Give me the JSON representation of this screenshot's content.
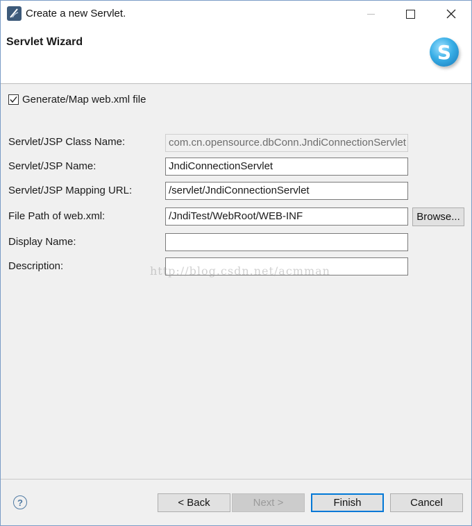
{
  "window": {
    "title": "Create a new Servlet.",
    "min_icon": "minimize-icon",
    "max_icon": "maximize-icon",
    "close_glyph": "✕"
  },
  "header": {
    "wizard_title": "Servlet Wizard",
    "logo_letter": "S"
  },
  "form": {
    "generate_checkbox": {
      "label": "Generate/Map web.xml file",
      "checked": true
    },
    "class_name": {
      "label": "Servlet/JSP Class Name:",
      "value": "com.cn.opensource.dbConn.JndiConnectionServlet"
    },
    "servlet_name": {
      "label": "Servlet/JSP Name:",
      "value": "JndiConnectionServlet"
    },
    "mapping_url": {
      "label": "Servlet/JSP Mapping URL:",
      "value": "/servlet/JndiConnectionServlet"
    },
    "file_path": {
      "label": "File Path of web.xml:",
      "value": "/JndiTest/WebRoot/WEB-INF"
    },
    "display_name": {
      "label": "Display Name:",
      "value": ""
    },
    "description": {
      "label": "Description:",
      "value": ""
    },
    "browse_label": "Browse..."
  },
  "watermark": "http://blog.csdn.net/acmman",
  "footer": {
    "help_glyph": "?",
    "back_label": "< Back",
    "next_label": "Next >",
    "finish_label": "Finish",
    "cancel_label": "Cancel"
  },
  "colors": {
    "accent": "#0078d7",
    "window_border": "#7a9cc6",
    "logo_blue": "#38aee6"
  }
}
